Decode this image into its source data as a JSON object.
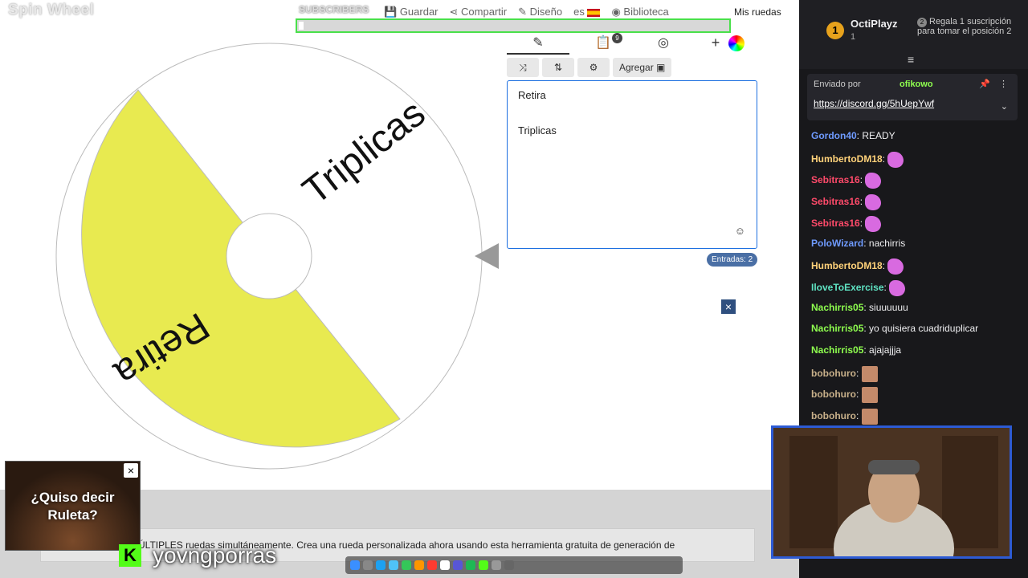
{
  "app": {
    "brand": "Spin Wheel",
    "subs_label": "SUBSCRIBERS",
    "nav": [
      "Guardar",
      "Compartir",
      "Diseño",
      "es",
      "Biblioteca",
      "Mis ruedas"
    ],
    "tabs_badge": "9",
    "add_button": "Agregar",
    "entries": [
      "Retira",
      "Triplicas"
    ],
    "entry_count": "Entradas: 2",
    "wheel": {
      "segments": [
        {
          "label": "Retira",
          "color": "#e8ea50"
        },
        {
          "label": "Triplicas",
          "color": "#ffffff"
        }
      ]
    },
    "ad": {
      "text": "¿Quiso decir Ruleta?"
    },
    "footer_text": "ÚLTIPLES ruedas simultáneamente. Crea una rueda personalizada ahora usando esta herramienta gratuita de generación de"
  },
  "stream": {
    "kick_logo": "K",
    "streamer": "yovngporras"
  },
  "chat": {
    "top_gifter": {
      "rank": "1",
      "name": "OctiPlayz",
      "count": "1",
      "note": "Regala 1 suscripción para tomar el posición 2",
      "rank2": "2"
    },
    "pinned": {
      "sent_by": "Enviado por",
      "user": "ofikowo",
      "link": "https://discord.gg/5hUepYwf"
    },
    "messages": [
      {
        "user": "Gordon40",
        "text": "READY",
        "color": "#6f9bff"
      },
      {
        "user": "HumbertoDM18",
        "text": "",
        "color": "#ffd27a"
      },
      {
        "user": "Sebitras16",
        "text": "",
        "color": "#ff4a6a"
      },
      {
        "user": "Sebitras16",
        "text": "",
        "color": "#ff4a6a"
      },
      {
        "user": "Sebitras16",
        "text": "",
        "color": "#ff4a6a"
      },
      {
        "user": "PoloWizard",
        "text": "nachirris",
        "color": "#6f9bff"
      },
      {
        "user": "HumbertoDM18",
        "text": "",
        "color": "#ffd27a"
      },
      {
        "user": "IloveToExercise",
        "text": "",
        "color": "#5fe3c3"
      },
      {
        "user": "Nachirris05",
        "text": "siuuuuuu",
        "color": "#8fff4f"
      },
      {
        "user": "Nachirris05",
        "text": "yo quisiera cuadriduplicar",
        "color": "#8fff4f"
      },
      {
        "user": "Nachirris05",
        "text": "ajajajjja",
        "color": "#8fff4f"
      },
      {
        "user": "bobohuro",
        "text": "",
        "color": "#c8b08a"
      },
      {
        "user": "bobohuro",
        "text": "",
        "color": "#c8b08a"
      },
      {
        "user": "bobohuro",
        "text": "",
        "color": "#c8b08a"
      }
    ]
  }
}
